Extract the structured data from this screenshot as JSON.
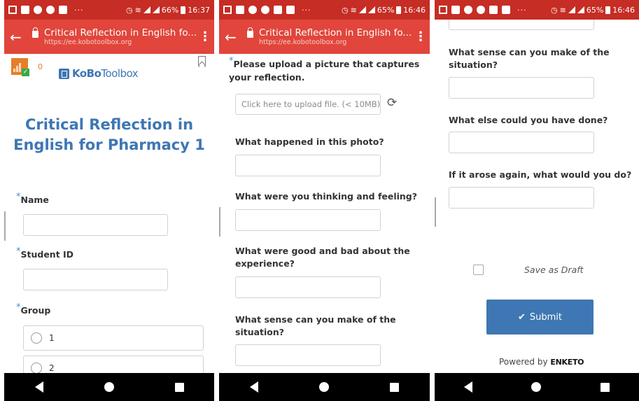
{
  "panels": [
    {
      "status": {
        "time": "16:37",
        "battery": "66%"
      },
      "appbar": {
        "title": "Critical Reflection in English fo...",
        "url": "https://ee.kobotoolbox.org"
      }
    },
    {
      "status": {
        "time": "16:46",
        "battery": "65%"
      },
      "appbar": {
        "title": "Critical Reflection in English fo...",
        "url": "https://ee.kobotoolbox.org"
      }
    },
    {
      "status": {
        "time": "16:46",
        "battery": "65%"
      }
    }
  ],
  "form": {
    "score": "0",
    "logo": {
      "part1": "KoBo",
      "part2": "Toolbox"
    },
    "title_line1": "Critical Reflection in",
    "title_line2": "English for Pharmacy 1",
    "required_marker": "*",
    "name_label": "Name",
    "student_id_label": "Student ID",
    "group_label": "Group",
    "group_options": [
      "1",
      "2"
    ],
    "upload_label_line1": "Please upload a picture that captures",
    "upload_label_line2": "your reflection.",
    "upload_placeholder": "Click here to upload file. (< 10MB)",
    "q_happened": "What happened in this photo?",
    "q_thinking": "What were you thinking and feeling?",
    "q_good_bad_line1": "What were good and bad about the",
    "q_good_bad_line2": "experience?",
    "q_sense_line1": "What sense can you make of the",
    "q_sense_line2": "situation?",
    "q_else": "What else could you have done?",
    "q_again": "If it arose again, what would you do?",
    "save_draft": "Save as Draft",
    "submit": "Submit",
    "powered_by": "Powered by",
    "enketo": "ENKETO"
  },
  "icons": {
    "nav": [
      "back-triangle-icon",
      "home-circle-icon",
      "recent-square-icon"
    ],
    "refresh": "refresh-icon",
    "bookmark": "bookmark-icon"
  },
  "colors": {
    "status_bar": "#c62d24",
    "app_bar": "#e1453b",
    "kobo_blue": "#3e77b3",
    "score_orange": "#e57e2a"
  }
}
